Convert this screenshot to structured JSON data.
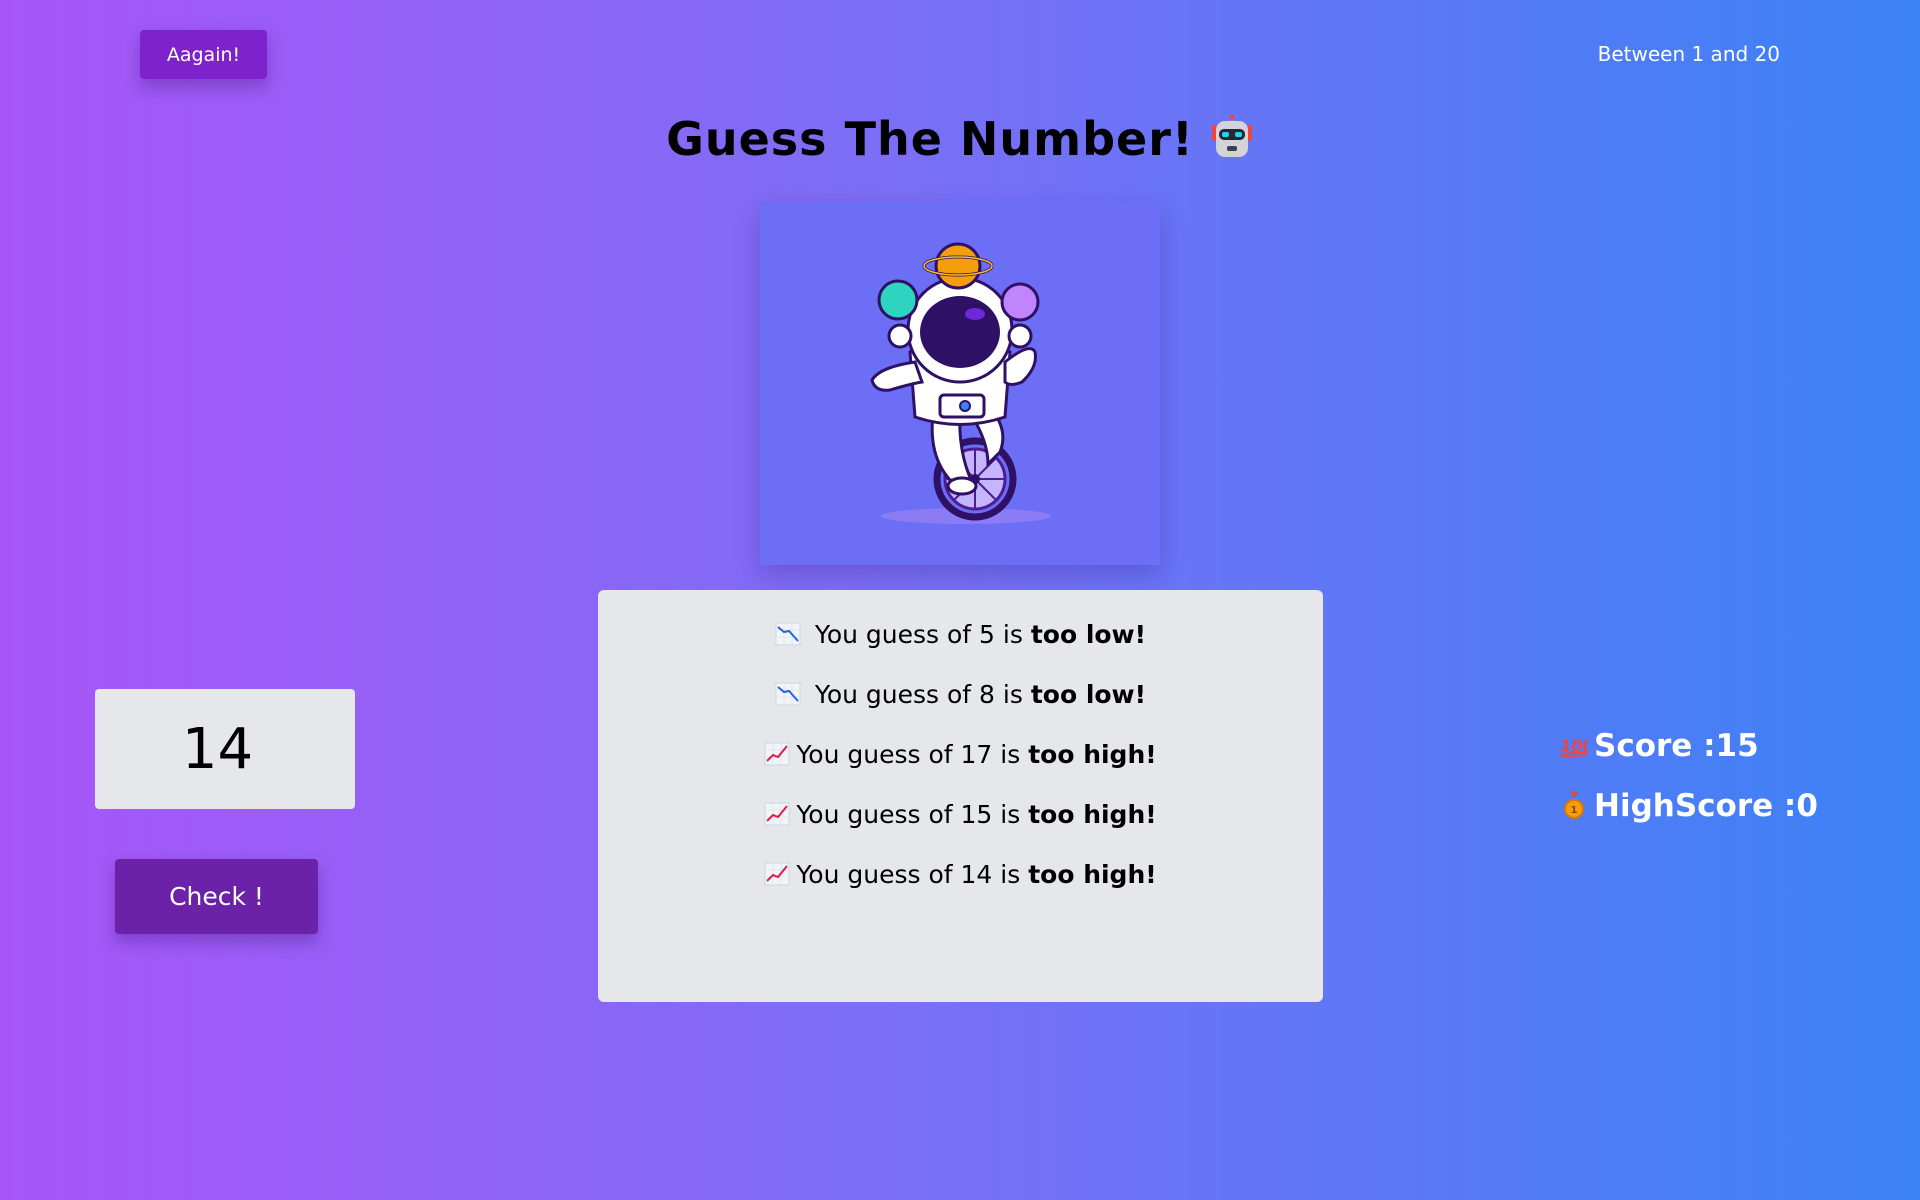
{
  "header": {
    "again_label": "Aagain!",
    "range_text": "Between 1 and 20",
    "title": "Guess The Number!",
    "title_icon": "robot-icon"
  },
  "image": {
    "subject": "astronaut-juggling-planets-on-unicycle"
  },
  "log": {
    "entries": [
      {
        "icon": "chart-decreasing-icon",
        "text": " You guess of 5 is ",
        "verdict": "too low!"
      },
      {
        "icon": "chart-decreasing-icon",
        "text": " You guess of 8 is ",
        "verdict": "too low!"
      },
      {
        "icon": "chart-increasing-icon",
        "text": "You guess of 17 is ",
        "verdict": "too high!"
      },
      {
        "icon": "chart-increasing-icon",
        "text": "You guess of 15 is ",
        "verdict": "too high!"
      },
      {
        "icon": "chart-increasing-icon",
        "text": "You guess of 14 is ",
        "verdict": "too high!"
      }
    ]
  },
  "input": {
    "value": "14"
  },
  "check_label": "Check !",
  "stats": {
    "score_label": "Score :15",
    "highscore_label": "HighScore :0",
    "score_icon": "hundred-points-icon",
    "highscore_icon": "medal-icon"
  },
  "colors": {
    "gradient_start": "#a855f7",
    "gradient_end": "#3b82f6",
    "button": "#7e22ce",
    "check_button": "#6b21a8",
    "panel": "#e5e7eb"
  }
}
